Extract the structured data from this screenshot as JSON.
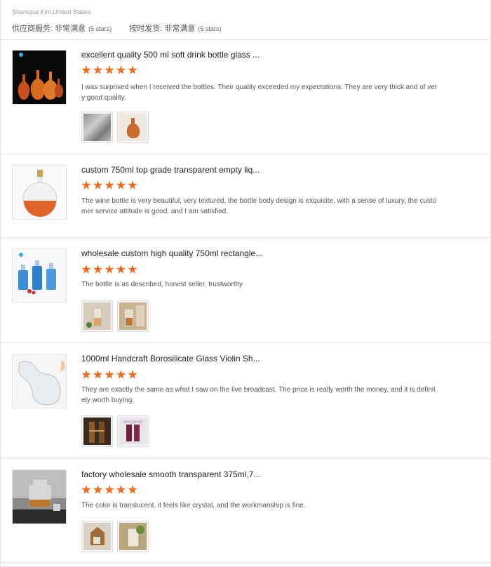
{
  "header": {
    "buyer": "Shaniqua Kim,United States",
    "supplier_service_label": "供应商服务: 非常满意",
    "supplier_service_stars": "(5 stars)",
    "shipping_label": "按时发货: 非常满意",
    "shipping_stars": "(5 stars)"
  },
  "star_color": "#f26a1b",
  "reviews": [
    {
      "title": "excellent quality 500 ml soft drink bottle glass ...",
      "rating": 5,
      "comment": "I was surprised when I received the bottles. Their quality exceeded my expectations. They are very thick and of very good quality.",
      "photo_count": 2
    },
    {
      "title": "custom 750ml top grade transparent empty liq...",
      "rating": 5,
      "comment": "The wine bottle is very beautiful, very textured, the bottle body design is exquisite, with a sense of luxury, the customer service attitude is good, and I am satisfied.",
      "photo_count": 0
    },
    {
      "title": "wholesale custom high quality 750ml rectangle...",
      "rating": 5,
      "comment": "The bottle is as described, honest seller, trustworthy",
      "photo_count": 2
    },
    {
      "title": "1000ml Handcraft Borosilicate Glass Violin Sh...",
      "rating": 5,
      "comment": "They are exactly the same as what I saw on the live broadcast. The price is really worth the money, and it is definitely worth buying.",
      "photo_count": 2
    },
    {
      "title": "factory wholesale smooth transparent 375ml,7...",
      "rating": 5,
      "comment": "The color is translucent, it feels like crystal, and the workmanship is fine.",
      "photo_count": 2
    }
  ]
}
